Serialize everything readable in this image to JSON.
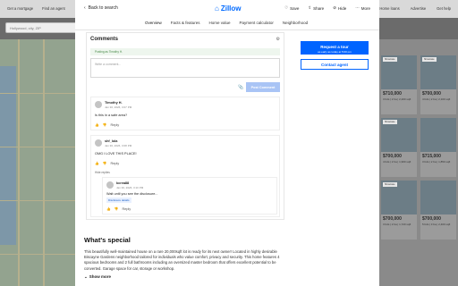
{
  "background": {
    "nav_left": [
      "Get a mortgage",
      "Find an agent"
    ],
    "nav_right": [
      "Home loans",
      "Advertise",
      "Get help"
    ],
    "search_placeholder": "Hollywood, city, ZIP",
    "listings": [
      {
        "price": "$710,000",
        "meta": "3 bds | 2 ba | 2,200 sqft",
        "tag": "Showcase"
      },
      {
        "price": "$700,000",
        "meta": "4 bds | 2 ba | 2,100 sqft",
        "tag": "Showcase"
      },
      {
        "price": "$700,000",
        "meta": "4 bds | 2 ba | 1,900 sqft",
        "tag": "Showcase"
      },
      {
        "price": "$715,000",
        "meta": "3 bds | 2 ba | 1,850 sqft",
        "tag": ""
      },
      {
        "price": "$700,000",
        "meta": "3 bds | 2 ba | 1,720 sqft",
        "tag": "Showcase"
      },
      {
        "price": "$700,000",
        "meta": "5 bds | 3 ba | 2,400 sqft",
        "tag": ""
      }
    ]
  },
  "modal": {
    "back_label": "Back to search",
    "logo_text": "Zillow",
    "actions": [
      {
        "label": "Save",
        "icon": "heart-icon"
      },
      {
        "label": "Share",
        "icon": "share-icon"
      },
      {
        "label": "Hide",
        "icon": "hide-icon"
      },
      {
        "label": "More",
        "icon": "more-icon"
      }
    ],
    "tabs": [
      "Overview",
      "Facts & features",
      "Home value",
      "Payment calculator",
      "Neighborhood"
    ],
    "active_tab": "Overview"
  },
  "comments": {
    "title": "Comments",
    "posting_as": "Posting as Timothy H.",
    "placeholder": "Write a comment...",
    "post_button": "Post Comment",
    "items": [
      {
        "name": "Timothy H.",
        "date": "Jan 30, 2026, 3:07 PM",
        "text": "Is this in a safe area?",
        "reply": "Reply"
      },
      {
        "name": "shf_lola",
        "date": "Jan 30, 2026, 3:08 PM",
        "text": "OMG I LOVE THIS PLACE!",
        "reply": "Reply"
      }
    ],
    "hide_replies": "Hide replies",
    "nested": {
      "name": "kcrea88",
      "date": "Jan 30, 2026, 3:10 PM",
      "text": "Wait until you see the disclosure...",
      "link": "Disclosure details",
      "reply": "Reply"
    }
  },
  "cta": {
    "request_tour": "Request a tour",
    "request_sub": "as early as today at 5:00 pm",
    "contact_agent": "Contact agent"
  },
  "special": {
    "title": "What's special",
    "description": "This beautifully well-maintained house on a rare 20,000sqft lot is ready for its next owner! Located in highly desirable Biscayne Gardens neighborhood tailored for individuals who value comfort, privacy and security. This home features 4 spacious bedrooms and 2 full bathrooms including an oversized master bedroom that offers excellent potential to be converted. Garage space for car, storage or workshop.",
    "show_more": "Show more"
  },
  "colors": {
    "accent": "#006aff",
    "button": "#0064ff",
    "post_disabled": "#a9c4f5"
  }
}
